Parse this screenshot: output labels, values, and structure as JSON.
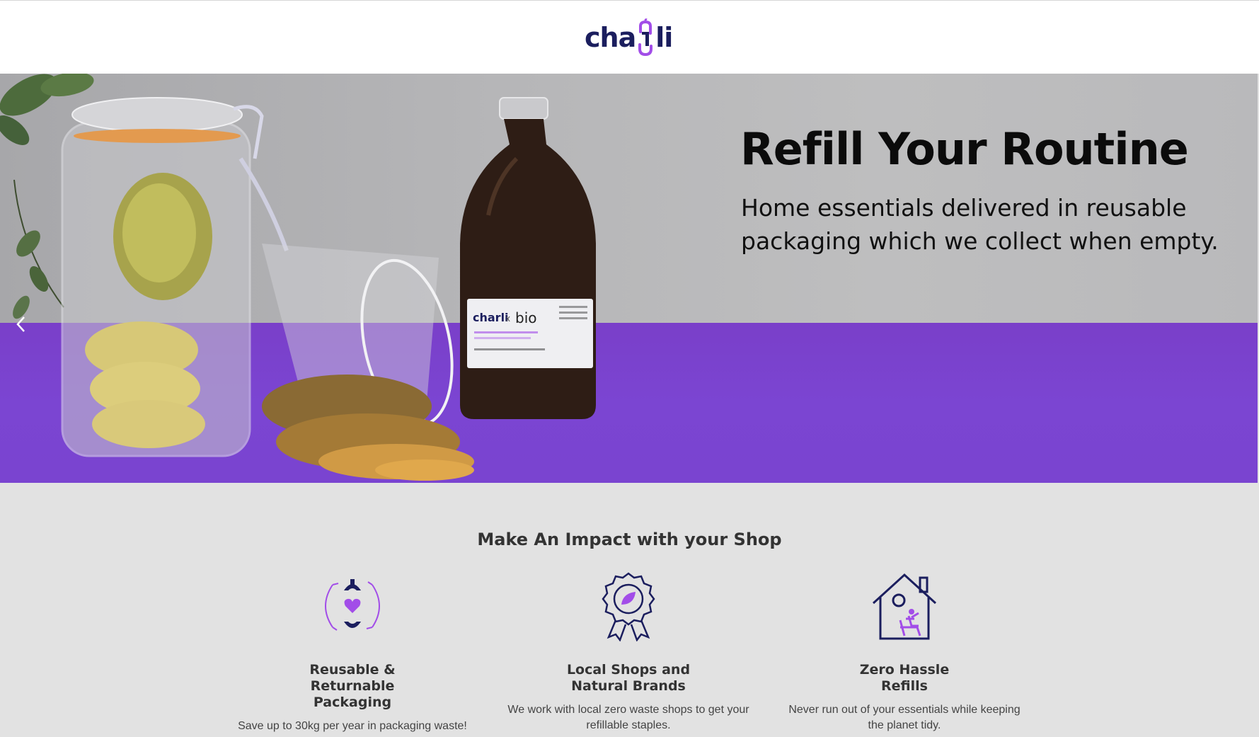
{
  "brand": {
    "logo_text_left": "cha",
    "logo_text_right": "li",
    "navy": "#1b1e5e",
    "purple": "#a24de8"
  },
  "hero": {
    "title": "Refill Your Routine",
    "subtitle": "Home essentials delivered in reusable packaging which we collect when empty.",
    "prev_icon": "chevron-left-icon",
    "label_brand": "charli",
    "label_partner": "bio",
    "label_cross": "x",
    "table_color": "#7b45d2"
  },
  "impact": {
    "title": "Make An Impact with your Shop",
    "features": [
      {
        "icon": "reusable-packaging-icon",
        "title": "Reusable & Returnable Packaging",
        "text": "Save up to 30kg per year in packaging waste!"
      },
      {
        "icon": "award-ribbon-icon",
        "title": "Local Shops and Natural Brands",
        "text": "We work with local zero waste shops to get your refillable staples."
      },
      {
        "icon": "home-relax-icon",
        "title": "Zero Hassle Refills",
        "text": "Never run out of your essentials while keeping the planet tidy."
      }
    ]
  }
}
